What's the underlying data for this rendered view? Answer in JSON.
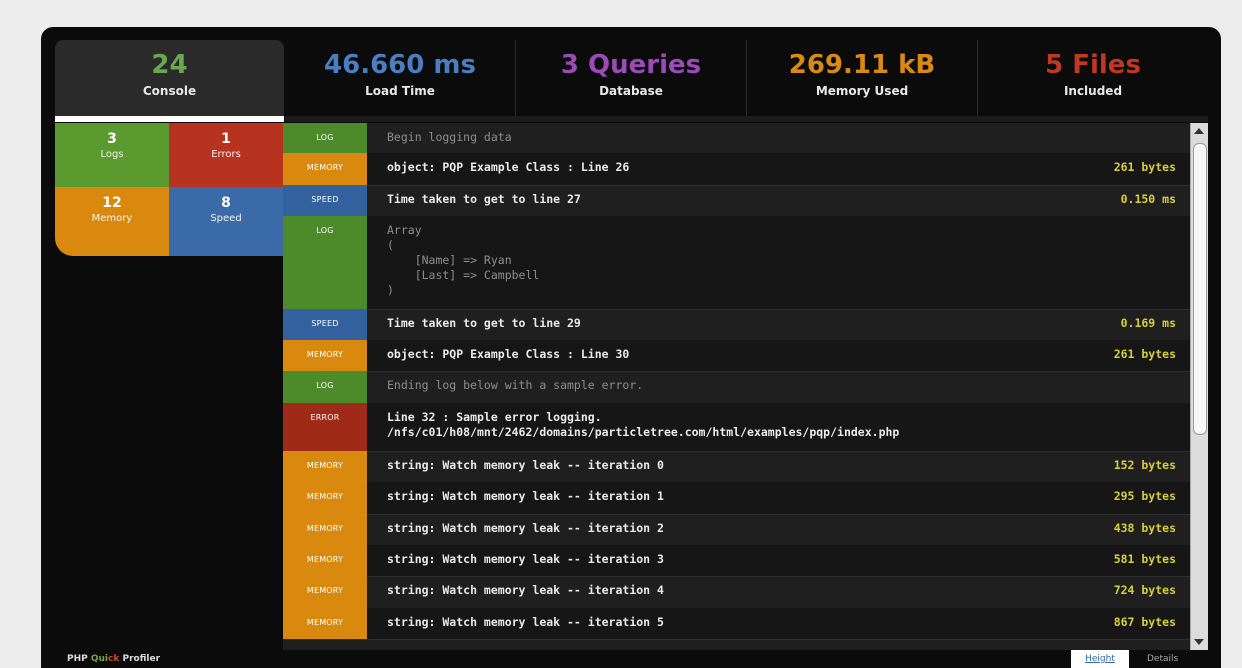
{
  "tabs": [
    {
      "value": "24",
      "label": "Console",
      "color": "#6aa84f"
    },
    {
      "value": "46.660 ms",
      "label": "Load Time",
      "color": "#4a7fbf"
    },
    {
      "value": "3 Queries",
      "label": "Database",
      "color": "#9b4ab8"
    },
    {
      "value": "269.11 kB",
      "label": "Memory Used",
      "color": "#d88a12"
    },
    {
      "value": "5 Files",
      "label": "Included",
      "color": "#c0381f"
    }
  ],
  "stats": [
    {
      "value": "3",
      "label": "Logs",
      "color": "#5a9a2e"
    },
    {
      "value": "1",
      "label": "Errors",
      "color": "#b83220"
    },
    {
      "value": "12",
      "label": "Memory",
      "color": "#d98a0e"
    },
    {
      "value": "8",
      "label": "Speed",
      "color": "#3a6aa8"
    }
  ],
  "badge_colors": {
    "log": "#4d8a2a",
    "memory": "#d98a0e",
    "speed": "#33619e",
    "error": "#a02a18"
  },
  "log_entries": [
    {
      "type": "log",
      "label": "LOG",
      "message": "Begin logging data",
      "value": "",
      "dim": true
    },
    {
      "type": "memory",
      "label": "MEMORY",
      "message": "object: PQP Example Class : Line 26",
      "value": "261 bytes",
      "dim": false
    },
    {
      "type": "speed",
      "label": "SPEED",
      "message": "Time taken to get to line 27",
      "value": "0.150 ms",
      "dim": false
    },
    {
      "type": "log",
      "label": "LOG",
      "message": "Array\n(\n    [Name] => Ryan\n    [Last] => Campbell\n)",
      "value": "",
      "dim": true
    },
    {
      "type": "speed",
      "label": "SPEED",
      "message": "Time taken to get to line 29",
      "value": "0.169 ms",
      "dim": false
    },
    {
      "type": "memory",
      "label": "MEMORY",
      "message": "object: PQP Example Class : Line 30",
      "value": "261 bytes",
      "dim": false
    },
    {
      "type": "log",
      "label": "LOG",
      "message": "Ending log below with a sample error.",
      "value": "",
      "dim": true
    },
    {
      "type": "error",
      "label": "ERROR",
      "message": "Line 32 : Sample error logging.\n/nfs/c01/h08/mnt/2462/domains/particletree.com/html/examples/pqp/index.php",
      "value": "",
      "dim": false
    },
    {
      "type": "memory",
      "label": "MEMORY",
      "message": "string: Watch memory leak -- iteration 0",
      "value": "152 bytes",
      "dim": false
    },
    {
      "type": "memory",
      "label": "MEMORY",
      "message": "string: Watch memory leak -- iteration 1",
      "value": "295 bytes",
      "dim": false
    },
    {
      "type": "memory",
      "label": "MEMORY",
      "message": "string: Watch memory leak -- iteration 2",
      "value": "438 bytes",
      "dim": false
    },
    {
      "type": "memory",
      "label": "MEMORY",
      "message": "string: Watch memory leak -- iteration 3",
      "value": "581 bytes",
      "dim": false
    },
    {
      "type": "memory",
      "label": "MEMORY",
      "message": "string: Watch memory leak -- iteration 4",
      "value": "724 bytes",
      "dim": false
    },
    {
      "type": "memory",
      "label": "MEMORY",
      "message": "string: Watch memory leak -- iteration 5",
      "value": "867 bytes",
      "dim": false
    }
  ],
  "footer": {
    "brand_php": "PHP",
    "brand_quick_q": "Qui",
    "brand_quick_k": "ck",
    "brand_profiler": "Profiler",
    "height_label": "Height",
    "details_label": "Details"
  }
}
